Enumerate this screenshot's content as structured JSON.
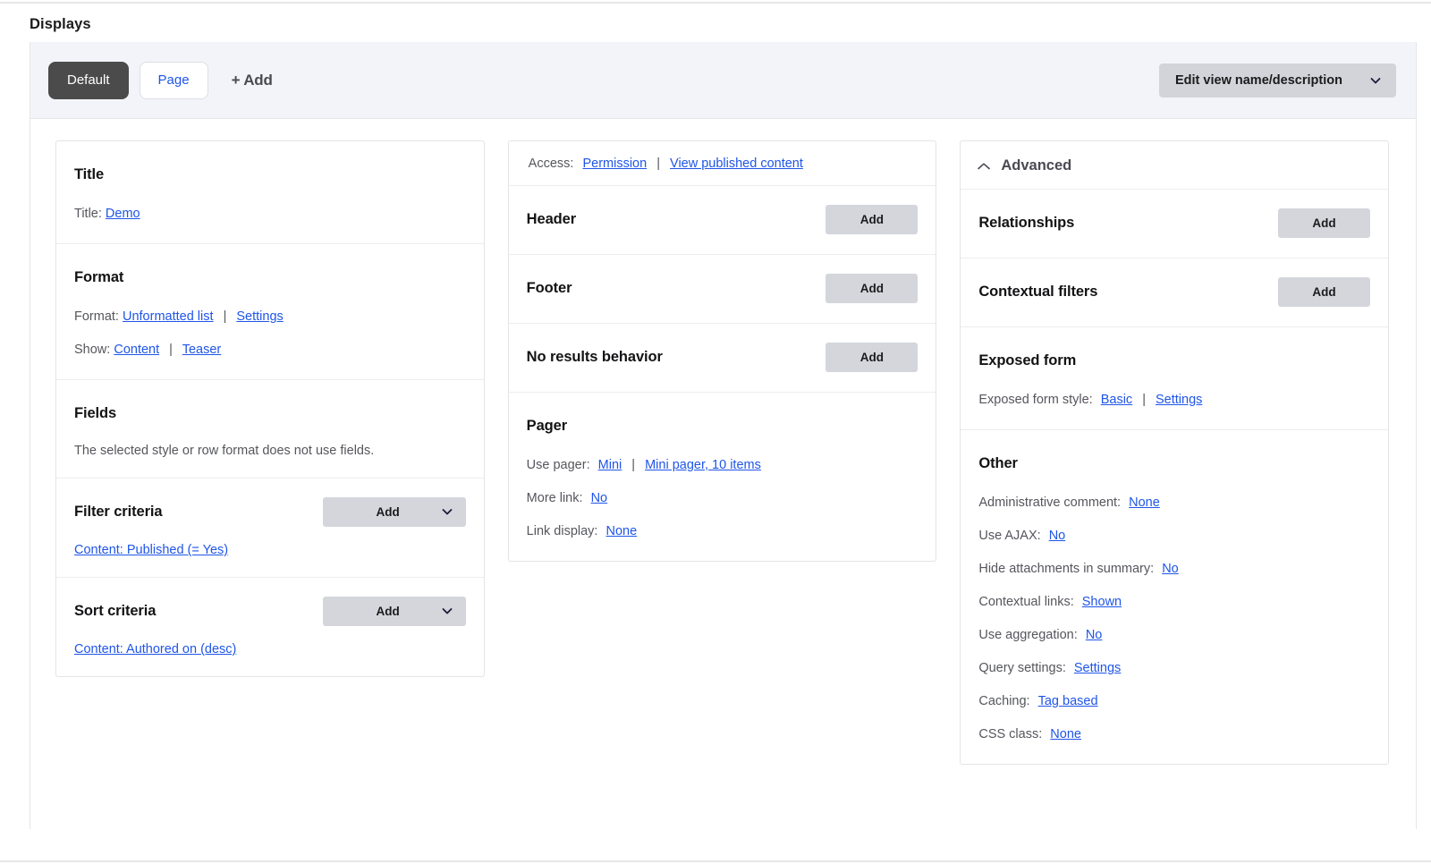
{
  "page": {
    "section_label": "Displays"
  },
  "display_bar": {
    "tabs": [
      {
        "label": "Default",
        "state": "active"
      },
      {
        "label": "Page",
        "state": "inactive"
      }
    ],
    "add_display_label": "+ Add",
    "view_actions": {
      "label": "Edit view name/description",
      "icon": "chevron-down-icon"
    }
  },
  "left_column": {
    "buckets": [
      {
        "title": "Title",
        "rows": [
          {
            "label": "Title:",
            "links": [
              "Demo"
            ]
          }
        ]
      },
      {
        "title": "Format",
        "rows": [
          {
            "label": "Format:",
            "links": [
              "Unformatted list",
              "Settings"
            ]
          },
          {
            "label": "Show:",
            "links": [
              "Content",
              "Teaser"
            ]
          }
        ]
      },
      {
        "title": "Fields",
        "note": "The selected style or row format does not use fields."
      },
      {
        "title": "Filter criteria",
        "action": {
          "label": "Add",
          "type": "dropbutton",
          "icon": "chevron-down-icon"
        },
        "items": [
          "Content: Published (= Yes)"
        ]
      },
      {
        "title": "Sort criteria",
        "action": {
          "label": "Add",
          "type": "dropbutton",
          "icon": "chevron-down-icon"
        },
        "items": [
          "Content: Authored on (desc)"
        ]
      }
    ]
  },
  "middle_column": {
    "access": {
      "label": "Access:",
      "links": [
        "Permission",
        "View published content"
      ]
    },
    "buckets": [
      {
        "title": "Header",
        "action": {
          "label": "Add",
          "type": "button"
        }
      },
      {
        "title": "Footer",
        "action": {
          "label": "Add",
          "type": "button"
        }
      },
      {
        "title": "No results behavior",
        "action": {
          "label": "Add",
          "type": "button"
        }
      },
      {
        "title": "Pager",
        "rows": [
          {
            "label": "Use pager:",
            "links": [
              "Mini",
              "Mini pager, 10 items"
            ]
          },
          {
            "label": "More link:",
            "links": [
              "No"
            ]
          },
          {
            "label": "Link display:",
            "links": [
              "None"
            ]
          }
        ]
      }
    ]
  },
  "right_column": {
    "advanced": {
      "label": "Advanced",
      "icon": "chevron-up-icon",
      "expanded": true
    },
    "buckets": [
      {
        "title": "Relationships",
        "action": {
          "label": "Add",
          "type": "button"
        }
      },
      {
        "title": "Contextual filters",
        "action": {
          "label": "Add",
          "type": "button"
        }
      },
      {
        "title": "Exposed form",
        "rows": [
          {
            "label": "Exposed form style:",
            "links": [
              "Basic",
              "Settings"
            ]
          }
        ]
      },
      {
        "title": "Other",
        "rows": [
          {
            "label": "Administrative comment:",
            "links": [
              "None"
            ]
          },
          {
            "label": "Use AJAX:",
            "links": [
              "No"
            ]
          },
          {
            "label": "Hide attachments in summary:",
            "links": [
              "No"
            ]
          },
          {
            "label": "Contextual links:",
            "links": [
              "Shown"
            ]
          },
          {
            "label": "Use aggregation:",
            "links": [
              "No"
            ]
          },
          {
            "label": "Query settings:",
            "links": [
              "Settings"
            ]
          },
          {
            "label": "Caching:",
            "links": [
              "Tag based"
            ]
          },
          {
            "label": "CSS class:",
            "links": [
              "None"
            ]
          }
        ]
      }
    ]
  },
  "colors": {
    "link": "#1f55e8",
    "active_tab_bg": "#4b4b4b",
    "button_bg": "#d4d6dc",
    "bar_bg": "#f3f4f9"
  }
}
